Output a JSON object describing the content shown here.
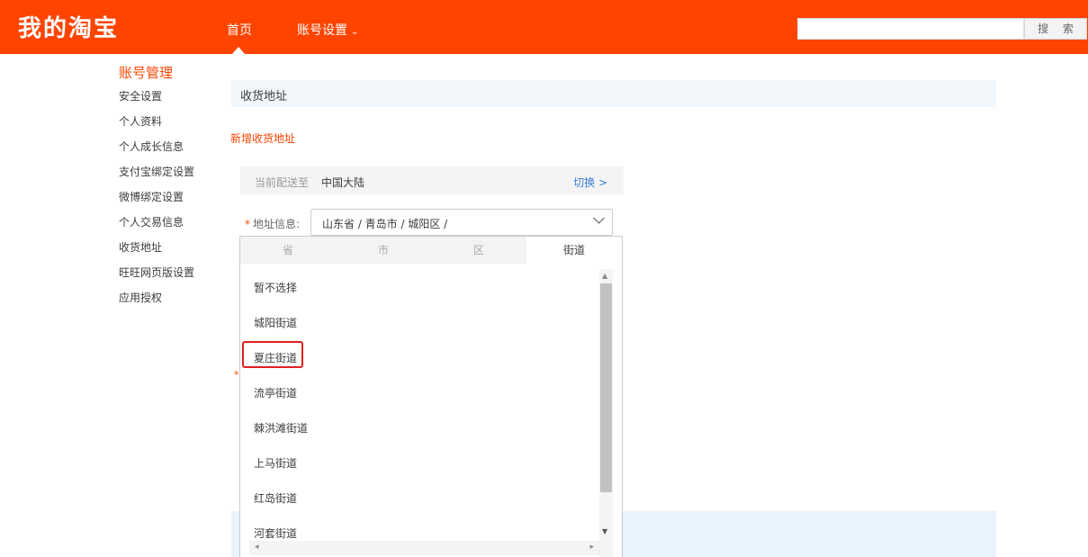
{
  "header": {
    "logo": "我的淘宝",
    "nav_home": "首页",
    "nav_settings": "账号设置",
    "search_button": "搜 索",
    "search_placeholder": "",
    "accent_color": "#ff4400"
  },
  "sidebar": {
    "title": "账号管理",
    "items": [
      {
        "label": "安全设置"
      },
      {
        "label": "个人资料"
      },
      {
        "label": "个人成长信息"
      },
      {
        "label": "支付宝绑定设置"
      },
      {
        "label": "微博绑定设置"
      },
      {
        "label": "个人交易信息"
      },
      {
        "label": "收货地址"
      },
      {
        "label": "旺旺网页版设置"
      },
      {
        "label": "应用授权"
      }
    ]
  },
  "main": {
    "panel_title": "收货地址",
    "new_address_link": "新增收货地址",
    "ship_to_label": "当前配送至",
    "ship_to_value": "中国大陆",
    "switch_link": "切换 >",
    "address_label": "地址信息:",
    "address_value": "山东省 / 青岛市 / 城阳区 /"
  },
  "dropdown": {
    "tabs": [
      {
        "label": "省"
      },
      {
        "label": "市"
      },
      {
        "label": "区"
      },
      {
        "label": "街道"
      }
    ],
    "active_tab": "街道",
    "options": [
      {
        "label": "暂不选择"
      },
      {
        "label": "城阳街道"
      },
      {
        "label": "夏庄街道"
      },
      {
        "label": "流亭街道"
      },
      {
        "label": "棘洪滩街道"
      },
      {
        "label": "上马街道"
      },
      {
        "label": "红岛街道"
      },
      {
        "label": "河套街道"
      }
    ],
    "highlighted_option": "夏庄街道"
  }
}
